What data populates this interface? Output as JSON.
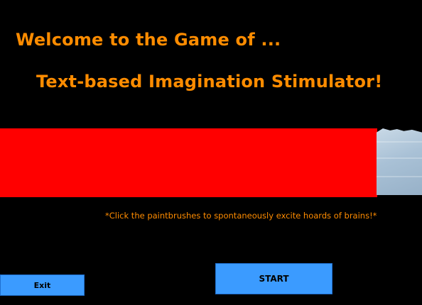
{
  "headings": {
    "line1": "Welcome to the Game of ...",
    "line2": "Text-based Imagination Stimulator!"
  },
  "hint": "*Click the paintbrushes to spontaneously excite hoards of brains!*",
  "buttons": {
    "exit": "Exit",
    "start": "START"
  },
  "colors": {
    "background": "#000000",
    "heading": "#FF8C00",
    "banner": "#FF0000",
    "button": "#3B9BFF"
  },
  "icons": {
    "paintbrush_image": "paintbrush-image"
  }
}
